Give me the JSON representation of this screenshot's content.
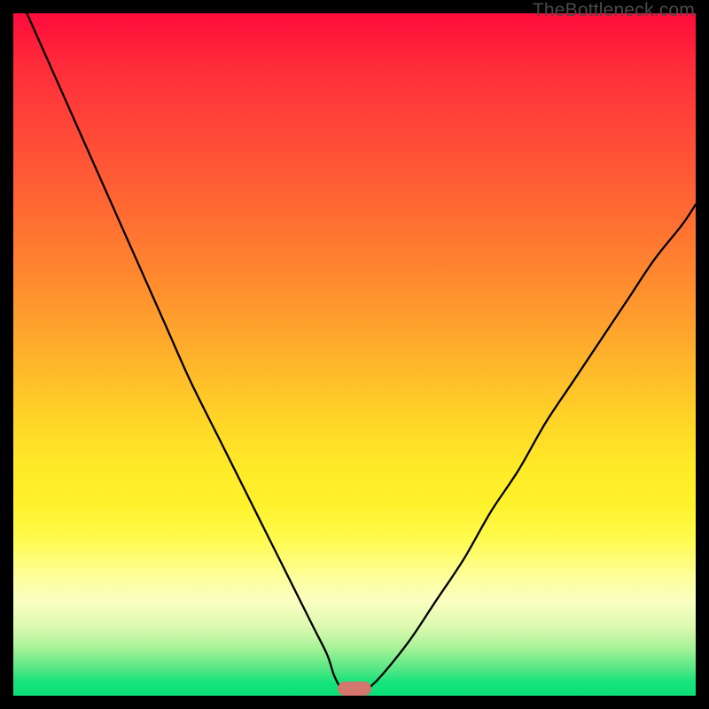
{
  "attribution": "TheBottleneck.com",
  "colors": {
    "page_bg": "#000000",
    "gradient_top": "#ff0b3b",
    "gradient_bottom": "#0be077",
    "curve": "#000000",
    "marker": "#d3766d",
    "attribution_text": "#4a4a4a"
  },
  "chart_data": {
    "type": "line",
    "title": "",
    "xlabel": "",
    "ylabel": "",
    "xlim": [
      0,
      100
    ],
    "ylim": [
      0,
      100
    ],
    "grid": false,
    "legend": false,
    "series": [
      {
        "name": "left-descent",
        "x": [
          2,
          6,
          10,
          14,
          18,
          22,
          26,
          30,
          34,
          38,
          42,
          44,
          46,
          47,
          48
        ],
        "y": [
          100,
          91,
          82,
          73,
          64,
          55,
          46,
          38,
          30,
          22,
          14,
          10,
          6,
          3,
          1
        ]
      },
      {
        "name": "valley-floor",
        "x": [
          48,
          50,
          52
        ],
        "y": [
          1,
          1,
          1
        ]
      },
      {
        "name": "right-ascent",
        "x": [
          52,
          54,
          58,
          62,
          66,
          70,
          74,
          78,
          82,
          86,
          90,
          94,
          98,
          100
        ],
        "y": [
          1,
          3,
          8,
          14,
          20,
          27,
          33,
          40,
          46,
          52,
          58,
          64,
          69,
          72
        ]
      }
    ],
    "marker": {
      "x": 50,
      "y": 1
    }
  }
}
